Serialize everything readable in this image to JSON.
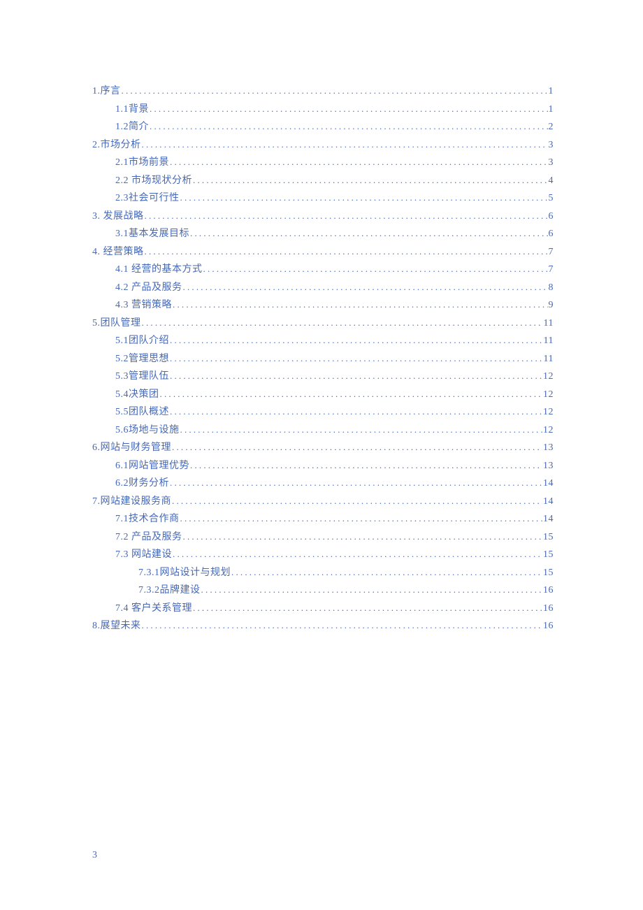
{
  "link_color": "#4668b8",
  "page_number": "3",
  "toc": [
    {
      "level": 1,
      "label": "1.序言",
      "page": "1"
    },
    {
      "level": 2,
      "label": "1.1背景",
      "page": "1"
    },
    {
      "level": 2,
      "label": "1.2简介",
      "page": "2"
    },
    {
      "level": 1,
      "label": "2.市场分析",
      "page": "3"
    },
    {
      "level": 2,
      "label": "2.1市场前景",
      "page": "3"
    },
    {
      "level": 2,
      "label": "2.2 市场现状分析",
      "page": "4"
    },
    {
      "level": 2,
      "label": "2.3社会可行性",
      "page": "5"
    },
    {
      "level": 1,
      "label": "3. 发展战略",
      "page": "6"
    },
    {
      "level": 2,
      "label": "3.1基本发展目标",
      "page": "6"
    },
    {
      "level": 1,
      "label": "4. 经营策略",
      "page": "7"
    },
    {
      "level": 2,
      "label": "4.1 经营的基本方式",
      "page": "7"
    },
    {
      "level": 2,
      "label": "4.2 产品及服务",
      "page": "8"
    },
    {
      "level": 2,
      "label": "4.3 营销策略",
      "page": "9"
    },
    {
      "level": 1,
      "label": "5.团队管理",
      "page": "11"
    },
    {
      "level": 2,
      "label": "5.1团队介绍",
      "page": "11"
    },
    {
      "level": 2,
      "label": "5.2管理思想",
      "page": "11"
    },
    {
      "level": 2,
      "label": "5.3管理队伍",
      "page": "12"
    },
    {
      "level": 2,
      "label": "5.4决策团",
      "page": "12"
    },
    {
      "level": 2,
      "label": "5.5团队概述",
      "page": "12"
    },
    {
      "level": 2,
      "label": "5.6场地与设施",
      "page": "12"
    },
    {
      "level": 1,
      "label": "6.网站与财务管理",
      "page": "13"
    },
    {
      "level": 2,
      "label": "6.1网站管理优势",
      "page": "13"
    },
    {
      "level": 2,
      "label": "6.2财务分析",
      "page": "14"
    },
    {
      "level": 1,
      "label": "7.网站建设服务商",
      "page": "14"
    },
    {
      "level": 2,
      "label": "7.1技术合作商",
      "page": "14"
    },
    {
      "level": 2,
      "label": "7.2 产品及服务",
      "page": "15"
    },
    {
      "level": 2,
      "label": "7.3 网站建设",
      "page": "15"
    },
    {
      "level": 3,
      "label": "7.3.1网站设计与规划",
      "page": "15"
    },
    {
      "level": 3,
      "label": "7.3.2品牌建设",
      "page": "16"
    },
    {
      "level": 2,
      "label": "7.4 客户关系管理",
      "page": "16"
    },
    {
      "level": 1,
      "label": "8.展望未来",
      "page": "16"
    }
  ]
}
